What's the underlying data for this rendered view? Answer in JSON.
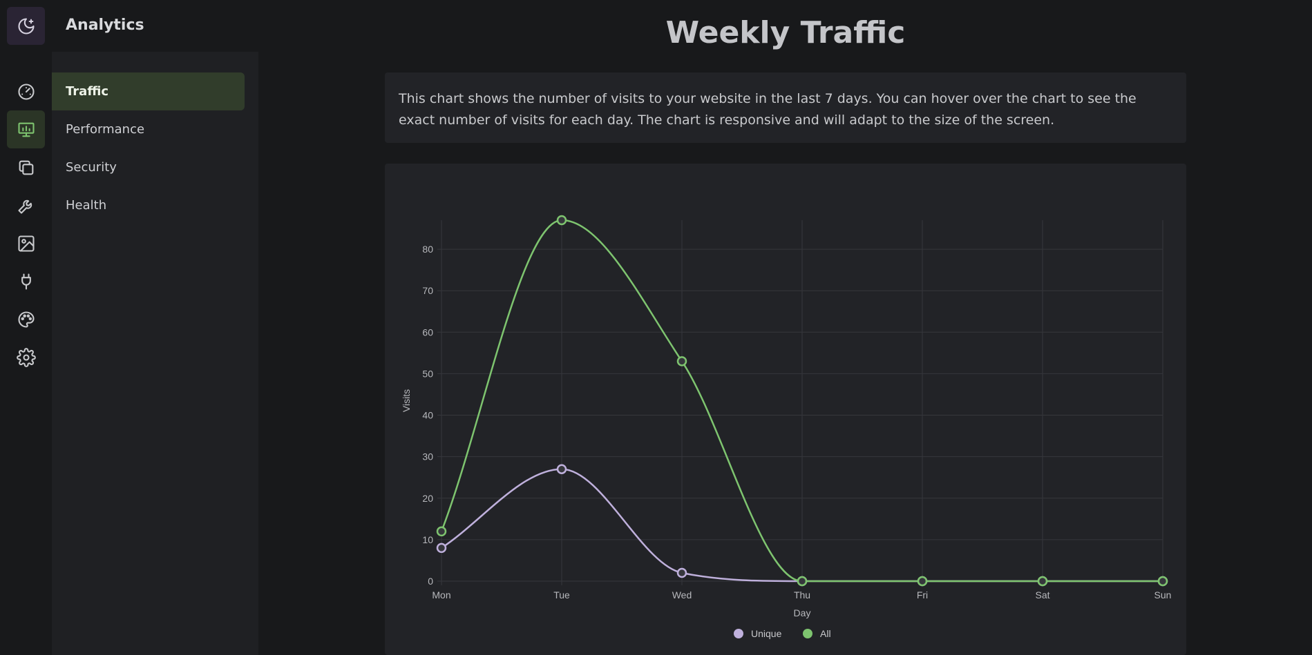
{
  "app": {
    "title": "Analytics"
  },
  "icon_rail": [
    {
      "icon": "gauge-icon",
      "active": false
    },
    {
      "icon": "presentation-chart-icon",
      "active": true
    },
    {
      "icon": "copy-icon",
      "active": false
    },
    {
      "icon": "wrench-icon",
      "active": false
    },
    {
      "icon": "image-icon",
      "active": false
    },
    {
      "icon": "plug-icon",
      "active": false
    },
    {
      "icon": "palette-icon",
      "active": false
    },
    {
      "icon": "gear-icon",
      "active": false
    }
  ],
  "logo": {
    "icon": "moon-stars-icon"
  },
  "sidebar": {
    "items": [
      {
        "label": "Traffic",
        "active": true
      },
      {
        "label": "Performance",
        "active": false
      },
      {
        "label": "Security",
        "active": false
      },
      {
        "label": "Health",
        "active": false
      }
    ]
  },
  "main": {
    "title": "Weekly Traffic",
    "description": "This chart shows the number of visits to your website in the last 7 days. You can hover over the chart to see the exact number of visits for each day. The chart is responsive and will adapt to the size of the screen."
  },
  "colors": {
    "accent_green": "#7ec46f",
    "accent_purple": "#bfb0dc",
    "active_nav": "#313d2b"
  },
  "chart_data": {
    "type": "line",
    "categories": [
      "Mon",
      "Tue",
      "Wed",
      "Thu",
      "Fri",
      "Sat",
      "Sun"
    ],
    "series": [
      {
        "name": "Unique",
        "values": [
          8,
          27,
          2,
          0,
          0,
          0,
          0
        ],
        "color": "#bfb0dc"
      },
      {
        "name": "All",
        "values": [
          12,
          87,
          53,
          0,
          0,
          0,
          0
        ],
        "color": "#7ec46f"
      }
    ],
    "xlabel": "Day",
    "ylabel": "Visits",
    "ylim": [
      0,
      87
    ],
    "yticks": [
      0,
      10,
      20,
      30,
      40,
      50,
      60,
      70,
      80
    ],
    "grid": true,
    "legend": "bottom-center",
    "smooth": true
  }
}
